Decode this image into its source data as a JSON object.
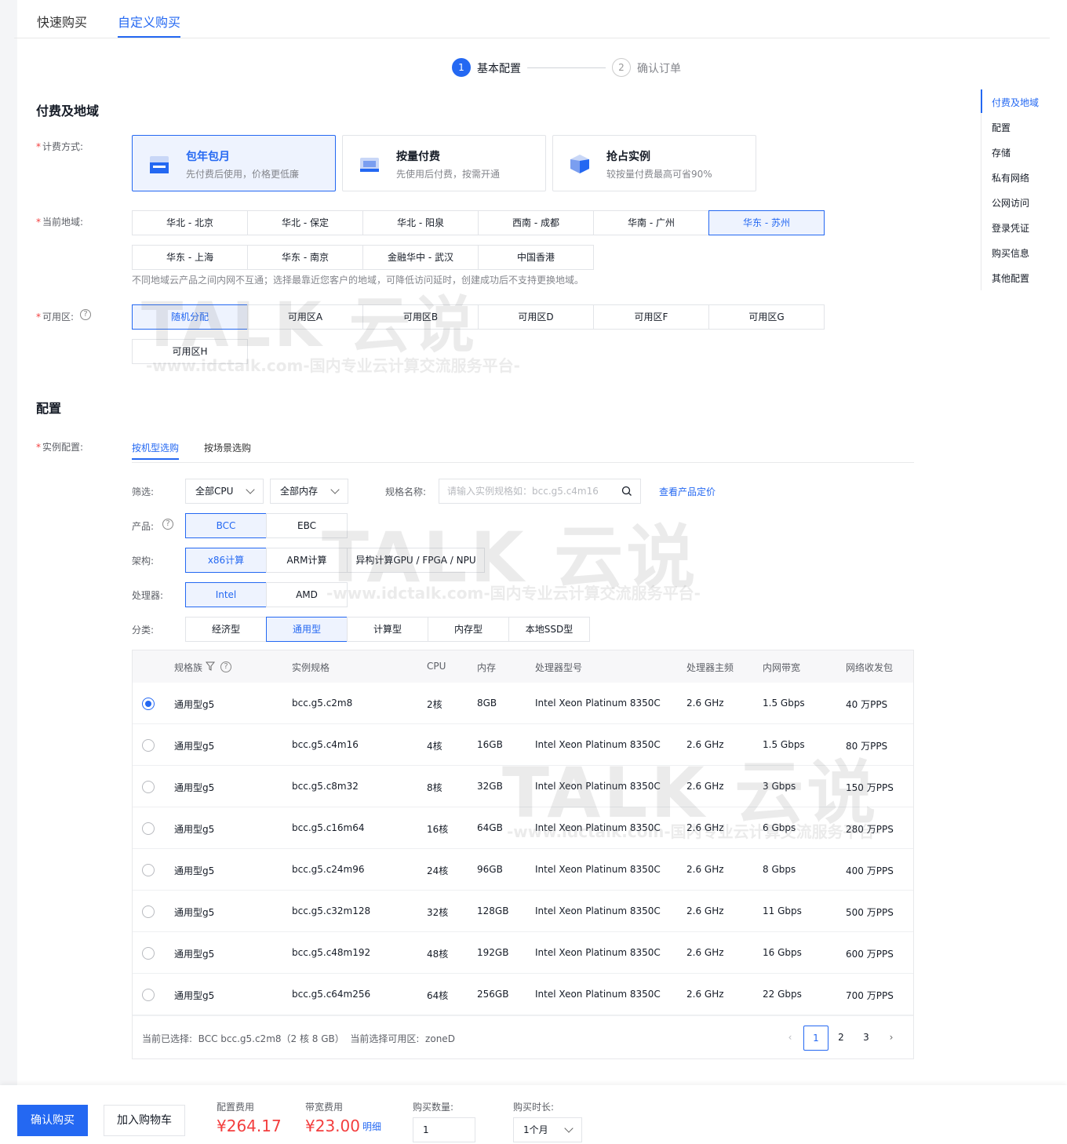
{
  "top_tabs": [
    "快速购买",
    "自定义购买"
  ],
  "steps": [
    {
      "num": "1",
      "label": "基本配置"
    },
    {
      "num": "2",
      "label": "确认订单"
    }
  ],
  "section_billing": "付费及地域",
  "section_config": "配置",
  "billing": {
    "label": "计费方式:",
    "options": [
      {
        "title": "包年包月",
        "desc": "先付费后使用，价格更低廉"
      },
      {
        "title": "按量付费",
        "desc": "先使用后付费，按需开通"
      },
      {
        "title": "抢占实例",
        "desc": "较按量付费最高可省90%"
      }
    ]
  },
  "region": {
    "label": "当前地域:",
    "row1": [
      "华北 - 北京",
      "华北 - 保定",
      "华北 - 阳泉",
      "西南 - 成都",
      "华南 - 广州",
      "华东 - 苏州"
    ],
    "row2": [
      "华东 - 上海",
      "华东 - 南京",
      "金融华中 - 武汉",
      "中国香港"
    ],
    "hint": "不同地域云产品之间内网不互通；选择最靠近您客户的地域，可降低访问延时，创建成功后不支持更换地域。"
  },
  "zone": {
    "label": "可用区:",
    "row1": [
      "随机分配",
      "可用区A",
      "可用区B",
      "可用区D",
      "可用区F",
      "可用区G"
    ],
    "row2": [
      "可用区H"
    ]
  },
  "instance": {
    "label": "实例配置:",
    "tabs": [
      "按机型选购",
      "按场景选购"
    ],
    "filter_label": "筛选:",
    "cpu_select": "全部CPU",
    "mem_select": "全部内存",
    "spec_name_label": "规格名称:",
    "spec_placeholder": "请输入实例规格如：bcc.g5.c4m16",
    "pricing_link": "查看产品定价",
    "product_label": "产品:",
    "product_options": [
      "BCC",
      "EBC"
    ],
    "arch_label": "架构:",
    "arch_options": [
      "x86计算",
      "ARM计算",
      "异构计算GPU / FPGA / NPU"
    ],
    "cpu_label": "处理器:",
    "cpu_options": [
      "Intel",
      "AMD"
    ],
    "category_label": "分类:",
    "category_options": [
      "经济型",
      "通用型",
      "计算型",
      "内存型",
      "本地SSD型"
    ]
  },
  "table": {
    "headers": [
      "规格族",
      "实例规格",
      "CPU",
      "内存",
      "处理器型号",
      "处理器主频",
      "内网带宽",
      "网络收发包"
    ],
    "rows": [
      [
        "通用型g5",
        "bcc.g5.c2m8",
        "2核",
        "8GB",
        "Intel Xeon Platinum 8350C",
        "2.6 GHz",
        "1.5 Gbps",
        "40 万PPS"
      ],
      [
        "通用型g5",
        "bcc.g5.c4m16",
        "4核",
        "16GB",
        "Intel Xeon Platinum 8350C",
        "2.6 GHz",
        "1.5 Gbps",
        "80 万PPS"
      ],
      [
        "通用型g5",
        "bcc.g5.c8m32",
        "8核",
        "32GB",
        "Intel Xeon Platinum 8350C",
        "2.6 GHz",
        "3 Gbps",
        "150 万PPS"
      ],
      [
        "通用型g5",
        "bcc.g5.c16m64",
        "16核",
        "64GB",
        "Intel Xeon Platinum 8350C",
        "2.6 GHz",
        "6 Gbps",
        "280 万PPS"
      ],
      [
        "通用型g5",
        "bcc.g5.c24m96",
        "24核",
        "96GB",
        "Intel Xeon Platinum 8350C",
        "2.6 GHz",
        "8 Gbps",
        "400 万PPS"
      ],
      [
        "通用型g5",
        "bcc.g5.c32m128",
        "32核",
        "128GB",
        "Intel Xeon Platinum 8350C",
        "2.6 GHz",
        "11 Gbps",
        "500 万PPS"
      ],
      [
        "通用型g5",
        "bcc.g5.c48m192",
        "48核",
        "192GB",
        "Intel Xeon Platinum 8350C",
        "2.6 GHz",
        "16 Gbps",
        "600 万PPS"
      ],
      [
        "通用型g5",
        "bcc.g5.c64m256",
        "64核",
        "256GB",
        "Intel Xeon Platinum 8350C",
        "2.6 GHz",
        "22 Gbps",
        "700 万PPS"
      ]
    ],
    "footer_selected": "当前已选择:  BCC bcc.g5.c2m8（2 核 8 GB）  当前选择可用区:  zoneD",
    "pages": [
      "1",
      "2",
      "3"
    ]
  },
  "anchor_nav": [
    "付费及地域",
    "配置",
    "存储",
    "私有网络",
    "公网访问",
    "登录凭证",
    "购买信息",
    "其他配置"
  ],
  "footer": {
    "confirm": "确认购买",
    "add_cart": "加入购物车",
    "config_fee_label": "配置费用",
    "config_fee": "¥264.17",
    "bw_fee_label": "带宽费用",
    "bw_fee": "¥23.00",
    "detail_link": "明细",
    "qty_label": "购买数量:",
    "qty_value": "1",
    "duration_label": "购买时长:",
    "duration_value": "1个月"
  },
  "watermark": {
    "logo": "TALK 云说",
    "tagline": "-www.idctalk.com-国内专业云计算交流服务平台-"
  },
  "colors": {
    "accent": "#2468f2",
    "price": "#f33e3e"
  }
}
